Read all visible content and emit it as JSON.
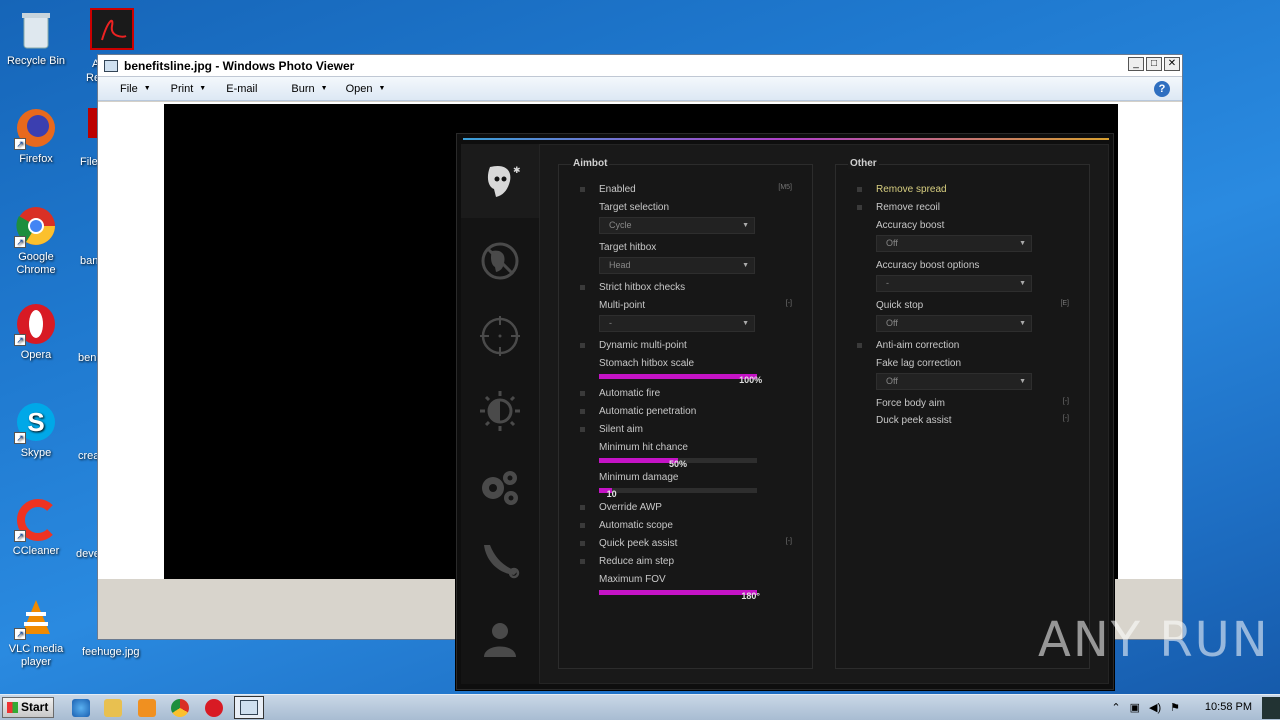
{
  "desktop": {
    "icons": [
      {
        "label": "Recycle Bin"
      },
      {
        "label": "Firefox"
      },
      {
        "label": "Google Chrome"
      },
      {
        "label": "Opera"
      },
      {
        "label": "Skype"
      },
      {
        "label": "CCleaner"
      },
      {
        "label": "VLC media player"
      }
    ],
    "partial_labels": [
      "A",
      "Re",
      "File",
      "ban",
      "ben",
      "crea",
      "deve",
      "feehuge.jpg"
    ]
  },
  "window": {
    "title": "benefitsline.jpg - Windows Photo Viewer",
    "menu": [
      {
        "label": "File",
        "dropdown": true
      },
      {
        "label": "Print",
        "dropdown": true
      },
      {
        "label": "E-mail",
        "dropdown": false
      },
      {
        "label": "Burn",
        "dropdown": true
      },
      {
        "label": "Open",
        "dropdown": true
      }
    ],
    "help": "?"
  },
  "menu": {
    "aimbot": {
      "title": "Aimbot",
      "enabled": {
        "label": "Enabled",
        "key": "[M5]"
      },
      "target_selection": {
        "label": "Target selection",
        "value": "Cycle"
      },
      "target_hitbox": {
        "label": "Target hitbox",
        "value": "Head"
      },
      "strict_hitbox": {
        "label": "Strict hitbox checks"
      },
      "multi_point": {
        "label": "Multi-point",
        "key": "[-]",
        "value": "-"
      },
      "dynamic_multi_point": {
        "label": "Dynamic multi-point"
      },
      "stomach_scale": {
        "label": "Stomach hitbox scale",
        "value_text": "100%",
        "fraction": 1.0
      },
      "automatic_fire": {
        "label": "Automatic fire"
      },
      "automatic_penetration": {
        "label": "Automatic penetration"
      },
      "silent_aim": {
        "label": "Silent aim"
      },
      "min_hit_chance": {
        "label": "Minimum hit chance",
        "value_text": "50%",
        "fraction": 0.5
      },
      "min_damage": {
        "label": "Minimum damage",
        "value_text": "10",
        "fraction": 0.08
      },
      "override_awp": {
        "label": "Override AWP"
      },
      "automatic_scope": {
        "label": "Automatic scope"
      },
      "quick_peek_assist": {
        "label": "Quick peek assist",
        "key": "[-]"
      },
      "reduce_aim_step": {
        "label": "Reduce aim step"
      },
      "max_fov": {
        "label": "Maximum FOV",
        "value_text": "180°",
        "fraction": 1.0
      }
    },
    "other": {
      "title": "Other",
      "remove_spread": {
        "label": "Remove spread"
      },
      "remove_recoil": {
        "label": "Remove recoil"
      },
      "accuracy_boost": {
        "label": "Accuracy boost",
        "value": "Off"
      },
      "accuracy_boost_options": {
        "label": "Accuracy boost options",
        "value": "-"
      },
      "quick_stop": {
        "label": "Quick stop",
        "key": "[E]",
        "value": "Off"
      },
      "anti_aim_correction": {
        "label": "Anti-aim correction"
      },
      "fake_lag_correction": {
        "label": "Fake lag correction",
        "value": "Off"
      },
      "force_body_aim": {
        "label": "Force body aim",
        "key": "[-]"
      },
      "duck_peek_assist": {
        "label": "Duck peek assist",
        "key": "[-]"
      }
    },
    "tabs": [
      {
        "name": "aimbot-tab",
        "icon": "masked-face-icon",
        "active": true
      },
      {
        "name": "anti-aim-tab",
        "icon": "crossed-face-icon",
        "active": false
      },
      {
        "name": "visuals-tab",
        "icon": "crosshair-icon",
        "active": false
      },
      {
        "name": "misc-tab",
        "icon": "brightness-icon",
        "active": false
      },
      {
        "name": "settings-tab",
        "icon": "gears-icon",
        "active": false
      },
      {
        "name": "skins-tab",
        "icon": "knife-icon",
        "active": false
      },
      {
        "name": "players-tab",
        "icon": "user-icon",
        "active": false
      }
    ],
    "accent_color": "#c513c6"
  },
  "taskbar": {
    "start_label": "Start",
    "clock": "10:58 PM"
  },
  "watermark": "ANY RUN"
}
